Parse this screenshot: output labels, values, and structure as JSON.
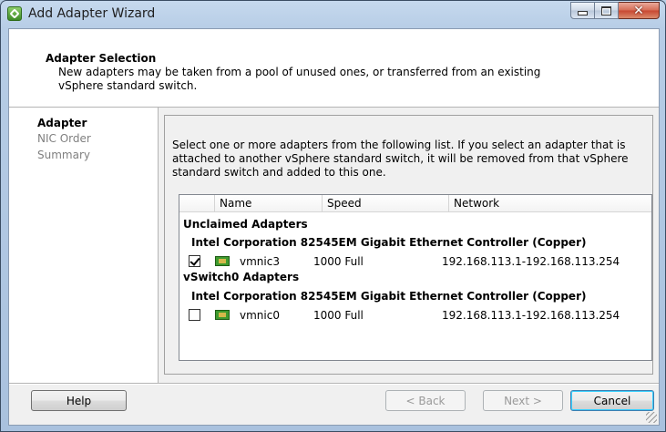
{
  "window": {
    "title": "Add Adapter Wizard"
  },
  "header": {
    "title": "Adapter Selection",
    "description": "New adapters may be taken from a pool of unused ones, or transferred from an existing vSphere standard switch."
  },
  "nav": {
    "items": [
      "Adapter",
      "NIC Order",
      "Summary"
    ]
  },
  "content": {
    "instructions": "Select one or more adapters from the following list. If you select an adapter that is attached to another vSphere standard switch, it will be removed from that vSphere standard switch and added to this one.",
    "columns": [
      "Name",
      "Speed",
      "Network"
    ],
    "groups": [
      {
        "label": "Unclaimed Adapters",
        "subgroup": "Intel Corporation 82545EM Gigabit Ethernet Controller (Copper)",
        "adapter": {
          "checked": true,
          "name": "vmnic3",
          "speed": "1000 Full",
          "network": "192.168.113.1-192.168.113.254"
        }
      },
      {
        "label": "vSwitch0 Adapters",
        "subgroup": "Intel Corporation 82545EM Gigabit Ethernet Controller (Copper)",
        "adapter": {
          "checked": false,
          "name": "vmnic0",
          "speed": "1000 Full",
          "network": "192.168.113.1-192.168.113.254"
        }
      }
    ]
  },
  "buttons": {
    "help": "Help",
    "back": "< Back",
    "next": "Next >",
    "cancel": "Cancel"
  },
  "icons": {
    "app": "vsphere-wizard-icon",
    "nic": "network-card-icon"
  }
}
